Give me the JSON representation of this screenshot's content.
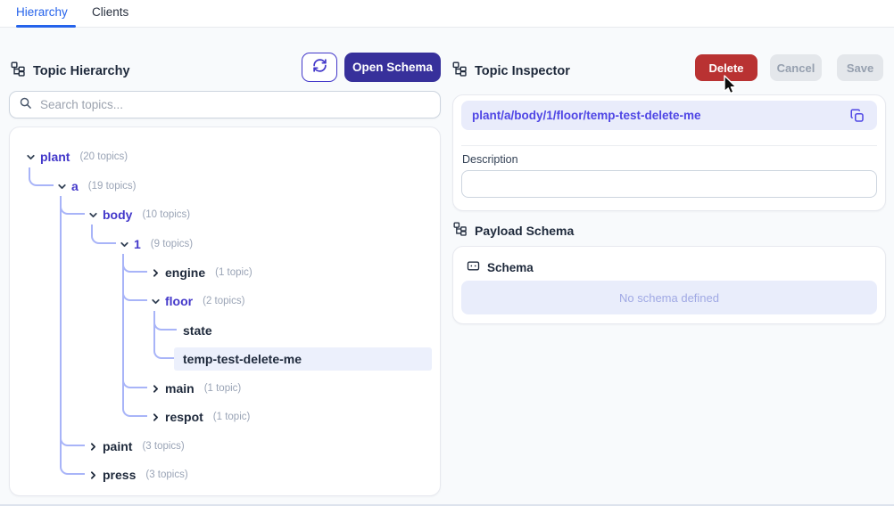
{
  "tabs": {
    "hierarchy": "Hierarchy",
    "clients": "Clients"
  },
  "left_panel": {
    "title": "Topic Hierarchy",
    "open_schema_label": "Open Schema",
    "search_placeholder": "Search topics...",
    "tree": {
      "nodes": [
        {
          "label": "plant",
          "count": "(20 topics)",
          "state": "expanded"
        },
        {
          "label": "a",
          "count": "(19 topics)",
          "state": "expanded"
        },
        {
          "label": "body",
          "count": "(10 topics)",
          "state": "expanded"
        },
        {
          "label": "1",
          "count": "(9 topics)",
          "state": "expanded"
        },
        {
          "label": "engine",
          "count": "(1 topic)",
          "state": "collapsed"
        },
        {
          "label": "floor",
          "count": "(2 topics)",
          "state": "expanded"
        },
        {
          "label": "state",
          "count": "",
          "state": "leaf"
        },
        {
          "label": "temp-test-delete-me",
          "count": "",
          "state": "leaf",
          "selected": true
        },
        {
          "label": "main",
          "count": "(1 topic)",
          "state": "collapsed"
        },
        {
          "label": "respot",
          "count": "(1 topic)",
          "state": "collapsed"
        },
        {
          "label": "paint",
          "count": "(3 topics)",
          "state": "collapsed"
        },
        {
          "label": "press",
          "count": "(3 topics)",
          "state": "collapsed"
        }
      ]
    }
  },
  "right_panel": {
    "title": "Topic Inspector",
    "delete_label": "Delete",
    "cancel_label": "Cancel",
    "save_label": "Save",
    "topic_path": "plant/a/body/1/floor/temp-test-delete-me",
    "description_label": "Description",
    "description_value": "",
    "payload_schema_title": "Payload Schema",
    "schema_label": "Schema",
    "no_schema_text": "No schema defined"
  },
  "colors": {
    "accent_blue": "#2563eb",
    "indigo_button": "#37309b",
    "indigo_text": "#4338ca",
    "tree_line": "#a8b4f8",
    "delete_red": "#b93232",
    "selected_row_bg": "#ecf0fc",
    "path_box_bg": "#e9ecfb"
  }
}
